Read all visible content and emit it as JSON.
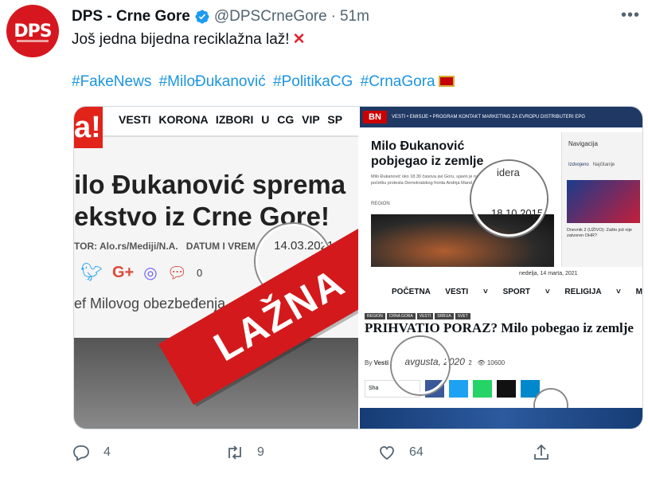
{
  "tweet": {
    "author_name": "DPS - Crne Gore",
    "handle": "@DPSCrneGore",
    "separator": "·",
    "time": "51m",
    "more_icon": "more-icon",
    "text": "Još jedna bijedna reciklažna laž!",
    "text_emoji": "cross-mark-icon",
    "hashtags": [
      "#FakeNews",
      "#MiloĐukanović",
      "#PolitikaCG",
      "#CrnaGora"
    ],
    "avatar_text": "DPS",
    "accent_color": "#1b95e0"
  },
  "media": {
    "left": {
      "logo_text": "a!",
      "nav": "VESTI KORONA IZBORI U CG VIP SP",
      "headline_line1": "ilo Đukanović sprema",
      "headline_line2": "ekstvo iz Crne Gore!",
      "meta_author": "TOR: Alo.rs/Mediji/N.A.",
      "meta_date_label": "DATUM I VREM",
      "meta_date": "14.03.2021.",
      "share_count": "0",
      "subtitle": "ef Milovog obezbeđenja",
      "banner_text": "LAŽNA"
    },
    "right_top": {
      "logo": "BN",
      "bar_text": "VESTI • EMISIJE • PROGRAM  KONTAKT  MARKETING  ZA EVROPU  DISTRIBUTERI  EPG",
      "title_line1": "Milo Đukanović",
      "title_line2": "pobjegao iz zemlje",
      "idera": "idera",
      "body": "Milo Đukanović oko 18.30 časova avi Goru, ujavio je na početku protesta Demokratskog fronta Andrija Mand",
      "region": "REGION",
      "date": "18.10.2015",
      "side_title": "Navigacija",
      "side_tab1": "Izdvojeno",
      "side_tab2": "Najčitanije",
      "side_caption": "Dnevnik 2 (UŽIVO): Zašto još nije zatvoren OHR?"
    },
    "right_bottom": {
      "date_bar": "nedelja, 14 marta, 2021",
      "nav": "POČETNA VESTI ˅ SPORT ˅ RELIGIJA ˅ MAGAZIN ˅ KO",
      "tags": [
        "REGION",
        "CRNA GORA",
        "VESTI",
        "SRBIJA",
        "SVET"
      ],
      "headline": "PRIHVATIO PORAZ? Milo pobegao iz zemlje",
      "by": "By",
      "author": "Vesti",
      "date": "avgusta, 2020",
      "comments": "2",
      "views": "10600",
      "share_label": "Sha"
    }
  },
  "actions": {
    "reply_count": "4",
    "retweet_count": "9",
    "like_count": "64"
  }
}
